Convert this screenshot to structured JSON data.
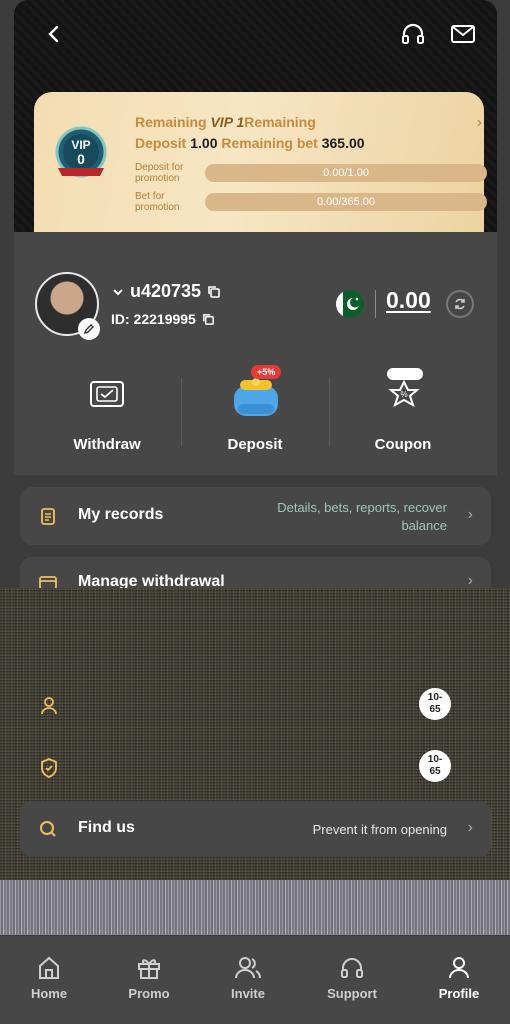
{
  "vip": {
    "remaining_prefix": "Remaining",
    "level": "VIP 1",
    "remaining_suffix": "Remaining",
    "deposit_label": "Deposit",
    "deposit_value": "1.00",
    "bet_label": "Remaining bet",
    "bet_value": "365.00",
    "deposit_promo_label": "Deposit for promotion",
    "deposit_promo_value": "0.00/1.00",
    "bet_promo_label": "Bet for promotion",
    "bet_promo_value": "0.00/365.00",
    "badge_text": "VIP",
    "badge_level": "0"
  },
  "user": {
    "username": "u420735",
    "id_text": "ID: 22219995",
    "balance": "0.00"
  },
  "actions": {
    "withdraw": "Withdraw",
    "deposit": "Deposit",
    "deposit_tag": "+5%",
    "coupon": "Coupon"
  },
  "menu": {
    "records_title": "My records",
    "records_desc_1": "Details, bets, reports, recover",
    "records_desc_2": "balance",
    "withdrawal_title": "Manage withdrawal",
    "findus_title": "Find us",
    "findus_desc": "Prevent it from opening"
  },
  "chips": {
    "chip1_line1": "10-",
    "chip1_line2": "65",
    "chip2_line1": "10-",
    "chip2_line2": "65"
  },
  "nav": {
    "home": "Home",
    "promo": "Promo",
    "invite": "Invite",
    "support": "Support",
    "profile": "Profile"
  },
  "colors": {
    "accent_gold": "#c88a3c",
    "vip_card": "#f3ddb1",
    "panel": "#474747",
    "link_green": "#9fc7b6"
  }
}
